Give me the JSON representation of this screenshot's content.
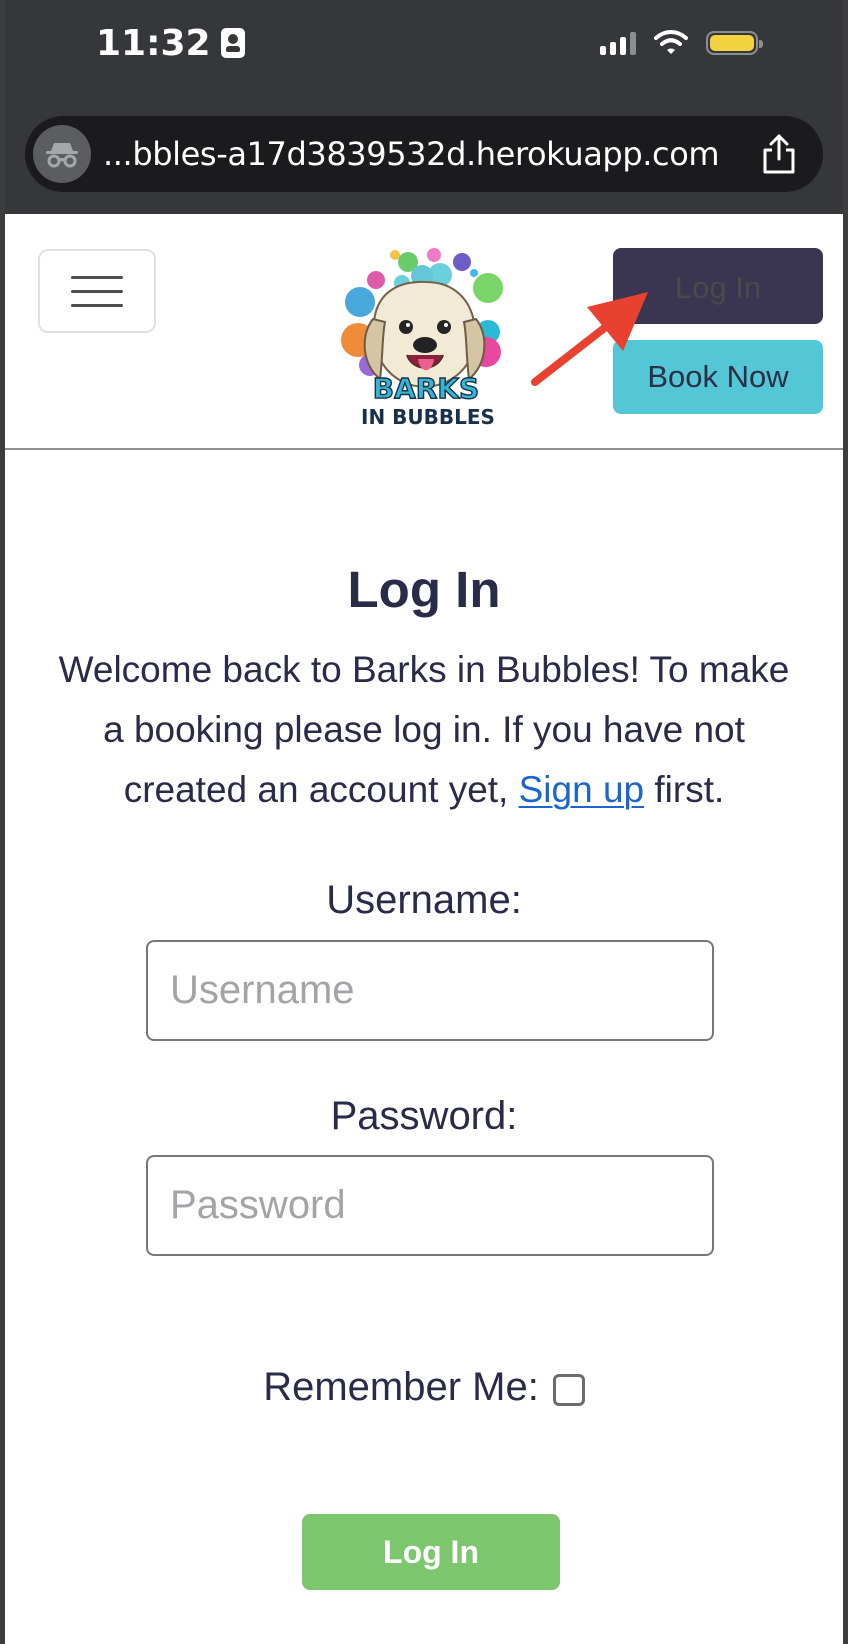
{
  "status_bar": {
    "time": "11:32",
    "icons": [
      "contact-card-icon",
      "cellular-signal-icon",
      "wifi-icon",
      "battery-icon"
    ],
    "battery_color": "#f4d341"
  },
  "browser": {
    "url": "...bbles-a17d3839532d.herokuapp.com",
    "left_icon": "incognito-icon",
    "right_icon": "share-icon"
  },
  "header": {
    "menu_icon": "hamburger-menu-icon",
    "logo": {
      "line1": "BARKS",
      "line2": "IN BUBBLES"
    },
    "login_button": "Log In",
    "book_button": "Book Now",
    "colors": {
      "login_bg": "#3a3551",
      "book_bg": "#53c7d5",
      "annotation_arrow": "#e8412f"
    }
  },
  "login_page": {
    "title": "Log In",
    "intro_before_link": "Welcome back to Barks in Bubbles! To make a booking please log in. If you have not created an account yet, ",
    "intro_link": "Sign up",
    "intro_after_link": " first.",
    "username_label": "Username:",
    "username_placeholder": "Username",
    "password_label": "Password:",
    "password_placeholder": "Password",
    "remember_label": "Remember Me:",
    "remember_checked": false,
    "submit_label": "Log In",
    "colors": {
      "text": "#292b48",
      "link": "#1a66d1",
      "submit_bg": "#7cc66d"
    }
  }
}
